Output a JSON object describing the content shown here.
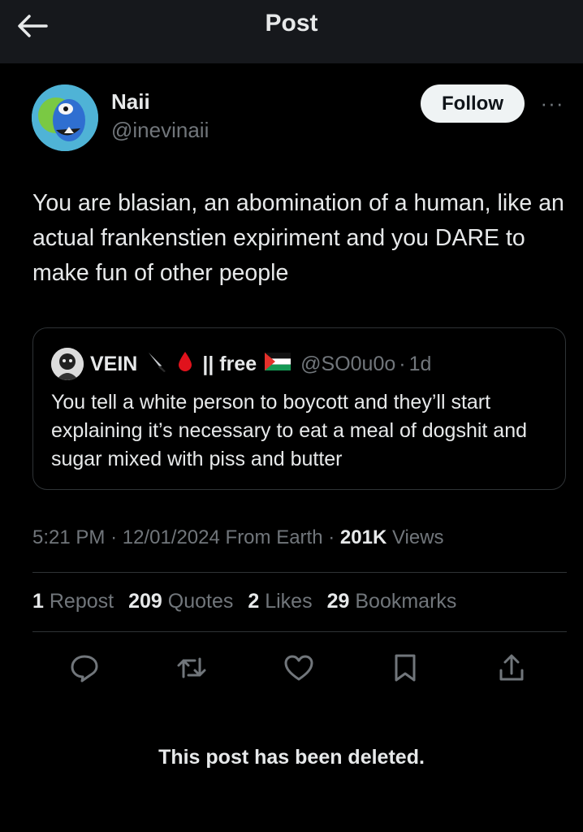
{
  "header": {
    "title": "Post",
    "back_icon": "arrow-left-icon"
  },
  "author": {
    "name": "Naii",
    "handle": "@inevinaii",
    "follow_label": "Follow",
    "more_label": "···"
  },
  "post": {
    "text": "You are blasian, an abomination of a human, like an actual frankenstien expiriment and you DARE to make fun of other people"
  },
  "quote": {
    "name": "VEIN",
    "name_suffix": "|| free",
    "emojis": [
      "knife-emoji",
      "drop-of-blood-emoji",
      "palestine-flag-emoji"
    ],
    "handle": "@SO0u0o",
    "separator": "·",
    "time": "1d",
    "text": "You tell a white person to boycott and they’ll start explaining it’s necessary to eat a meal of dogshit and sugar mixed with piss and butter"
  },
  "meta": {
    "time": "5:21 PM",
    "dot1": "·",
    "date": "12/01/2024",
    "source": "From Earth",
    "dot2": "·",
    "views_count": "201K",
    "views_label": "Views"
  },
  "stats": {
    "reposts_count": "1",
    "reposts_label": "Repost",
    "quotes_count": "209",
    "quotes_label": "Quotes",
    "likes_count": "2",
    "likes_label": "Likes",
    "bookmarks_count": "29",
    "bookmarks_label": "Bookmarks"
  },
  "actions": [
    "reply-icon",
    "repost-icon",
    "like-icon",
    "bookmark-icon",
    "share-icon"
  ],
  "deleted_notice": "This post has been deleted.",
  "colors": {
    "background": "#000000",
    "header_bg": "#16181c",
    "text": "#e7e9ea",
    "muted": "#71767b",
    "border": "#2f3336",
    "follow_bg": "#eff3f4"
  }
}
